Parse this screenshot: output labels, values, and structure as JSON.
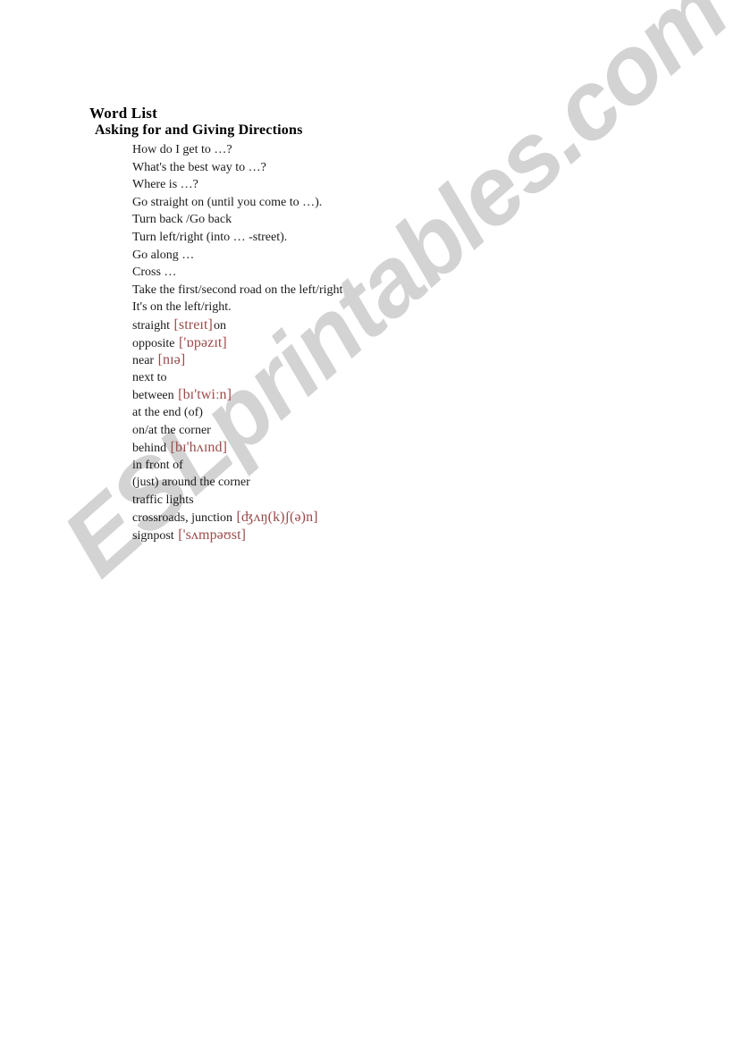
{
  "document": {
    "title": "Word List",
    "subtitle": "Asking for and Giving Directions",
    "entries": [
      {
        "text": "How do I get to …?",
        "ipa": "",
        "tail": ""
      },
      {
        "text": "What's the best way to …?",
        "ipa": "",
        "tail": ""
      },
      {
        "text": "Where is …?",
        "ipa": "",
        "tail": ""
      },
      {
        "text": "Go straight on (until you come to …).",
        "ipa": "",
        "tail": ""
      },
      {
        "text": "Turn back /Go back",
        "ipa": "",
        "tail": ""
      },
      {
        "text": "Turn left/right (into … -street).",
        "ipa": "",
        "tail": ""
      },
      {
        "text": "Go along …",
        "ipa": "",
        "tail": ""
      },
      {
        "text": "Cross …",
        "ipa": "",
        "tail": ""
      },
      {
        "text": "Take the first/second road on the left/right",
        "ipa": "",
        "tail": ""
      },
      {
        "text": "It's on the left/right.",
        "ipa": "",
        "tail": ""
      },
      {
        "text": "straight ",
        "ipa": "[streɪt]",
        "tail": "on"
      },
      {
        "text": "opposite ",
        "ipa": "['ɒpəzɪt]",
        "tail": ""
      },
      {
        "text": "near ",
        "ipa": "[nɪə]",
        "tail": ""
      },
      {
        "text": "next to",
        "ipa": "",
        "tail": ""
      },
      {
        "text": "between ",
        "ipa": "[bɪ'twiːn]",
        "tail": ""
      },
      {
        "text": "at the end (of)",
        "ipa": "",
        "tail": ""
      },
      {
        "text": "on/at the corner",
        "ipa": "",
        "tail": ""
      },
      {
        "text": "behind ",
        "ipa": "[bɪ'hʌɪnd]",
        "tail": ""
      },
      {
        "text": "in front of",
        "ipa": "",
        "tail": ""
      },
      {
        "text": "(just) around the corner",
        "ipa": "",
        "tail": ""
      },
      {
        "text": "traffic lights",
        "ipa": "",
        "tail": ""
      },
      {
        "text": "crossroads, junction ",
        "ipa": "[ʤʌŋ(k)ʃ(ə)n]",
        "tail": ""
      },
      {
        "text": "signpost ",
        "ipa": "['sʌmpəʊst]",
        "tail": ""
      }
    ]
  },
  "watermark": {
    "text": "ESLprintables.com",
    "color": "#d2d3d2"
  },
  "colors": {
    "page_background": "#ffffff",
    "body_text": "#1a1a1a",
    "heading_text": "#000000",
    "ipa_text": "#9c4a4a"
  }
}
